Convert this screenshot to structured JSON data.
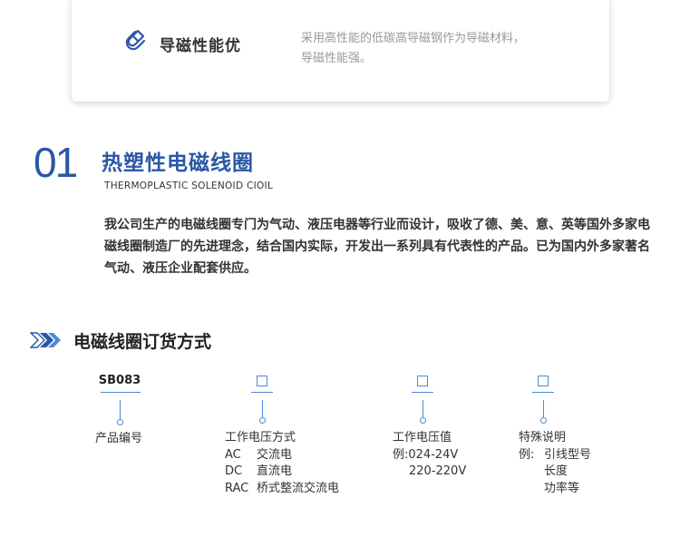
{
  "feature": {
    "title": "导磁性能优",
    "desc_line1": "采用高性能的低碳高导磁钢作为导磁材料，",
    "desc_line2": "导磁性能强。"
  },
  "section": {
    "number": "01",
    "title": "热塑性电磁线圈",
    "subtitle": "THERMOPLASTIC SOLENOID CIOIL",
    "body": "我公司生产的电磁线圈专门为气动、液压电器等行业而设计，吸收了德、美、意、英等国外多家电磁线圈制造厂的先进理念，结合国内实际，开发出一系列具有代表性的产品。已为国内外多家著名气动、液压企业配套供应。"
  },
  "order": {
    "title": "电磁线圈订货方式",
    "code": "SB083",
    "col1": {
      "label": "产品编号"
    },
    "col2": {
      "title": "工作电压方式",
      "rows": [
        {
          "key": "AC",
          "val": "交流电"
        },
        {
          "key": "DC",
          "val": "直流电"
        },
        {
          "key": "RAC",
          "val": "桥式整流交流电"
        }
      ]
    },
    "col3": {
      "title": "工作电压值",
      "line1": "例:024-24V",
      "line2": "220-220V"
    },
    "col4": {
      "title": "特殊说明",
      "prefix": "例:",
      "line1": "引线型号",
      "line2": "长度",
      "line3": "功率等"
    }
  },
  "colors": {
    "accent": "#2a57a6",
    "line": "#4a8bd6"
  },
  "icons": {
    "feature": "magnet-icon",
    "order": "double-chevron-icon"
  }
}
